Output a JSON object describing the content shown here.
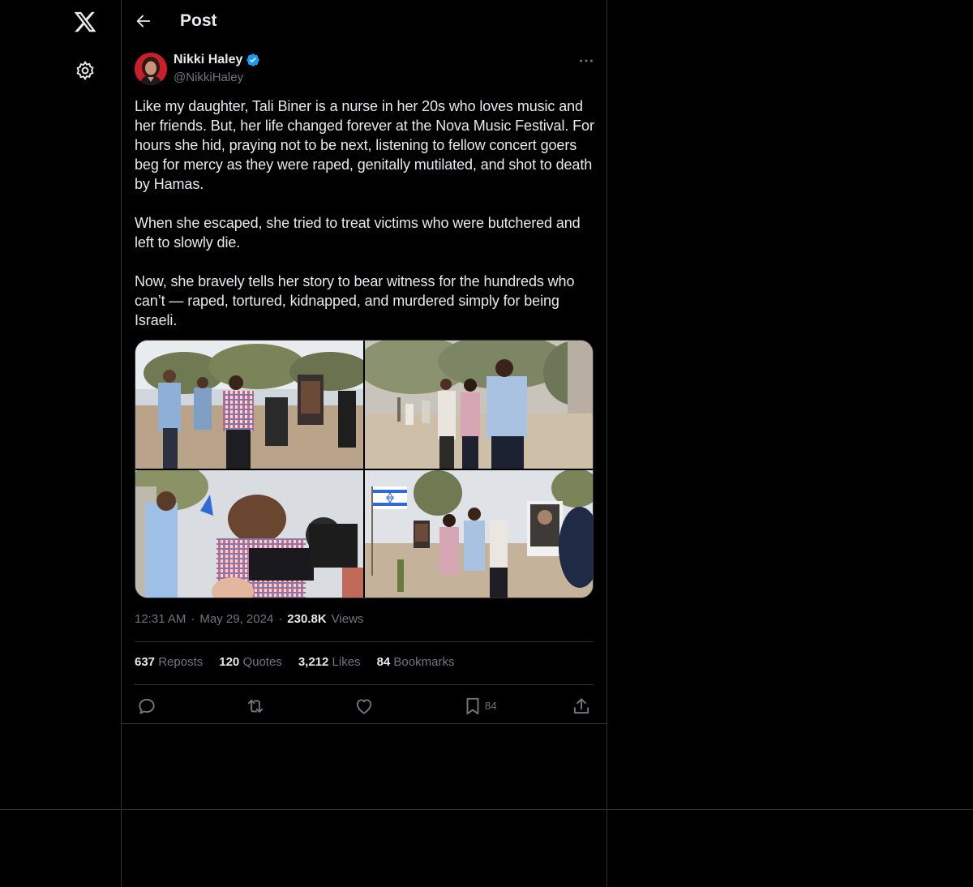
{
  "header": {
    "title": "Post"
  },
  "author": {
    "name": "Nikki Haley",
    "handle": "@NikkiHaley"
  },
  "post": {
    "text": "Like my daughter, Tali Biner is a nurse in her 20s who loves music and her friends. But, her life changed forever at the Nova Music Festival. For hours she hid, praying not to be next, listening to fellow concert goers beg for mercy as they were raped, genitally mutilated, and shot to death by Hamas.\n\nWhen she escaped, she tried to treat victims who were butchered and left to slowly die.\n\nNow, she bravely tells her story to bear witness for the hundreds who can’t — raped, tortured, kidnapped, and murdered simply for being Israeli.",
    "time": "12:31 AM",
    "date": "May 29, 2024",
    "views_count": "230.8K",
    "views_label": "Views",
    "separator": "·"
  },
  "stats": {
    "reposts_count": "637",
    "reposts_label": "Reposts",
    "quotes_count": "120",
    "quotes_label": "Quotes",
    "likes_count": "3,212",
    "likes_label": "Likes",
    "bookmarks_count": "84",
    "bookmarks_label": "Bookmarks"
  },
  "actions": {
    "bookmark_count": "84"
  },
  "icons": {
    "logo": "x-logo-icon",
    "settings": "gear-icon",
    "back": "back-arrow-icon",
    "verified": "verified-badge-icon",
    "more": "more-icon",
    "reply": "reply-icon",
    "repost": "repost-icon",
    "like": "heart-icon",
    "bookmark": "bookmark-icon",
    "share": "share-icon"
  },
  "colors": {
    "background": "#000000",
    "text": "#e7e9ea",
    "muted": "#71767b",
    "border": "#2f3336",
    "verified": "#1d9bf0"
  }
}
